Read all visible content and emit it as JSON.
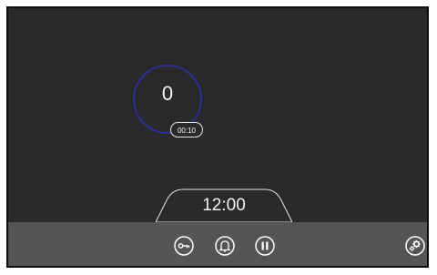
{
  "counter": {
    "value": "0",
    "small_timer": "00:10"
  },
  "clock": {
    "time": "12:00"
  },
  "colors": {
    "screen_bg": "#2a2a2c",
    "bar_bg": "#555558",
    "ring": "#2f2f8e",
    "text": "#f2f2f2"
  },
  "icons": {
    "key": "key-icon",
    "bell": "bell-icon",
    "pause": "pause-icon",
    "settings": "gear-icon"
  }
}
